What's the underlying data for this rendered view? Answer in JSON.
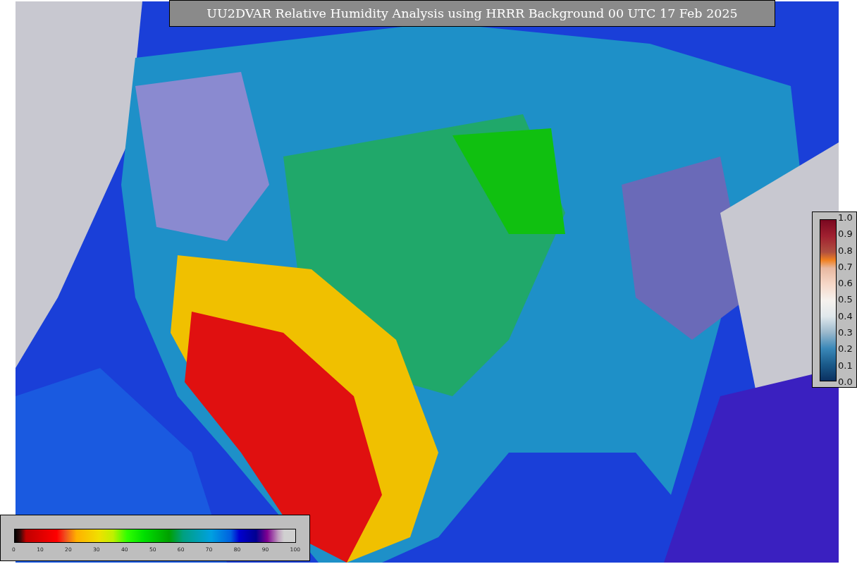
{
  "title": "UU2DVAR Relative Humidity Analysis using HRRR Background 00 UTC 17 Feb 2025",
  "humidity_colorbar": {
    "ticks": [
      "0",
      "10",
      "20",
      "30",
      "40",
      "50",
      "60",
      "70",
      "80",
      "90",
      "100"
    ]
  },
  "observation_colorbar": {
    "ticks": [
      "1.0",
      "0.9",
      "0.8",
      "0.7",
      "0.6",
      "0.5",
      "0.4",
      "0.3",
      "0.2",
      "0.1",
      "0.0"
    ]
  }
}
